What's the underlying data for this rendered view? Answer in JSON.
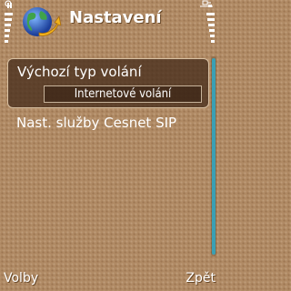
{
  "header": {
    "title": "Nastavení",
    "app_icon": "globe-arrow-icon",
    "signal_icon": "signal-strength-icon",
    "status_icons": [
      "connection-icon",
      "battery-icon"
    ]
  },
  "list": {
    "items": [
      {
        "label": "Výchozí typ volání",
        "value": "Internetové volání",
        "selected": true
      },
      {
        "label": "Nast. služby Cesnet SIP"
      }
    ]
  },
  "softkeys": {
    "left": "Volby",
    "right": "Zpět"
  },
  "colors": {
    "background": "#b08a64",
    "selection": "#48301c",
    "scroll_accent": "#3aa0b4",
    "text": "#ffffff"
  }
}
